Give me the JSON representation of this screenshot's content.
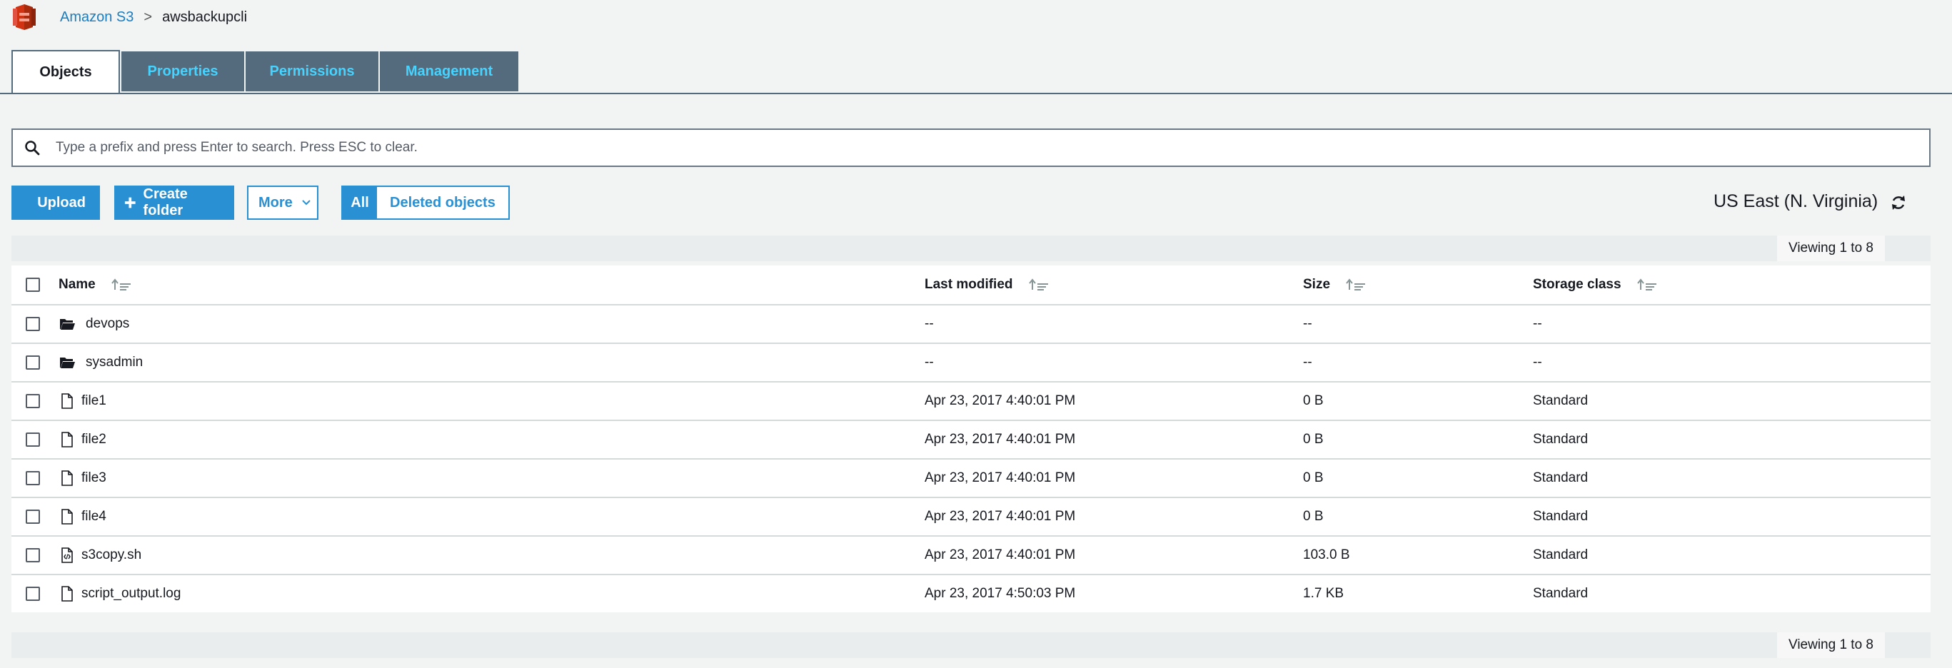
{
  "breadcrumb": {
    "root": "Amazon S3",
    "separator": ">",
    "current": "awsbackupcli"
  },
  "tabs": [
    {
      "label": "Objects",
      "active": true
    },
    {
      "label": "Properties",
      "active": false
    },
    {
      "label": "Permissions",
      "active": false
    },
    {
      "label": "Management",
      "active": false
    }
  ],
  "search": {
    "placeholder": "Type a prefix and press Enter to search. Press ESC to clear.",
    "value": ""
  },
  "toolbar": {
    "upload_label": "Upload",
    "create_folder_label": "Create folder",
    "more_label": "More",
    "filter_all_label": "All",
    "filter_deleted_label": "Deleted objects"
  },
  "region": "US East (N. Virginia)",
  "viewing": {
    "top": "Viewing 1 to 8",
    "bottom": "Viewing 1 to 8"
  },
  "table": {
    "columns": [
      "Name",
      "Last modified",
      "Size",
      "Storage class"
    ],
    "rows": [
      {
        "icon": "folder-icon",
        "name": "devops",
        "modified": "--",
        "size": "--",
        "storage": "--"
      },
      {
        "icon": "folder-icon",
        "name": "sysadmin",
        "modified": "--",
        "size": "--",
        "storage": "--"
      },
      {
        "icon": "file-icon",
        "name": "file1",
        "modified": "Apr 23, 2017 4:40:01 PM",
        "size": "0 B",
        "storage": "Standard"
      },
      {
        "icon": "file-icon",
        "name": "file2",
        "modified": "Apr 23, 2017 4:40:01 PM",
        "size": "0 B",
        "storage": "Standard"
      },
      {
        "icon": "file-icon",
        "name": "file3",
        "modified": "Apr 23, 2017 4:40:01 PM",
        "size": "0 B",
        "storage": "Standard"
      },
      {
        "icon": "file-icon",
        "name": "file4",
        "modified": "Apr 23, 2017 4:40:01 PM",
        "size": "0 B",
        "storage": "Standard"
      },
      {
        "icon": "code-file-icon",
        "name": "s3copy.sh",
        "modified": "Apr 23, 2017 4:40:01 PM",
        "size": "103.0 B",
        "storage": "Standard"
      },
      {
        "icon": "file-icon",
        "name": "script_output.log",
        "modified": "Apr 23, 2017 4:50:03 PM",
        "size": "1.7 KB",
        "storage": "Standard"
      }
    ]
  },
  "colors": {
    "accent": "#2a90d4",
    "tab_bg": "#546b7e",
    "tab_text": "#45d3ff",
    "link": "#1a7dbf",
    "logo": "#d13212"
  }
}
